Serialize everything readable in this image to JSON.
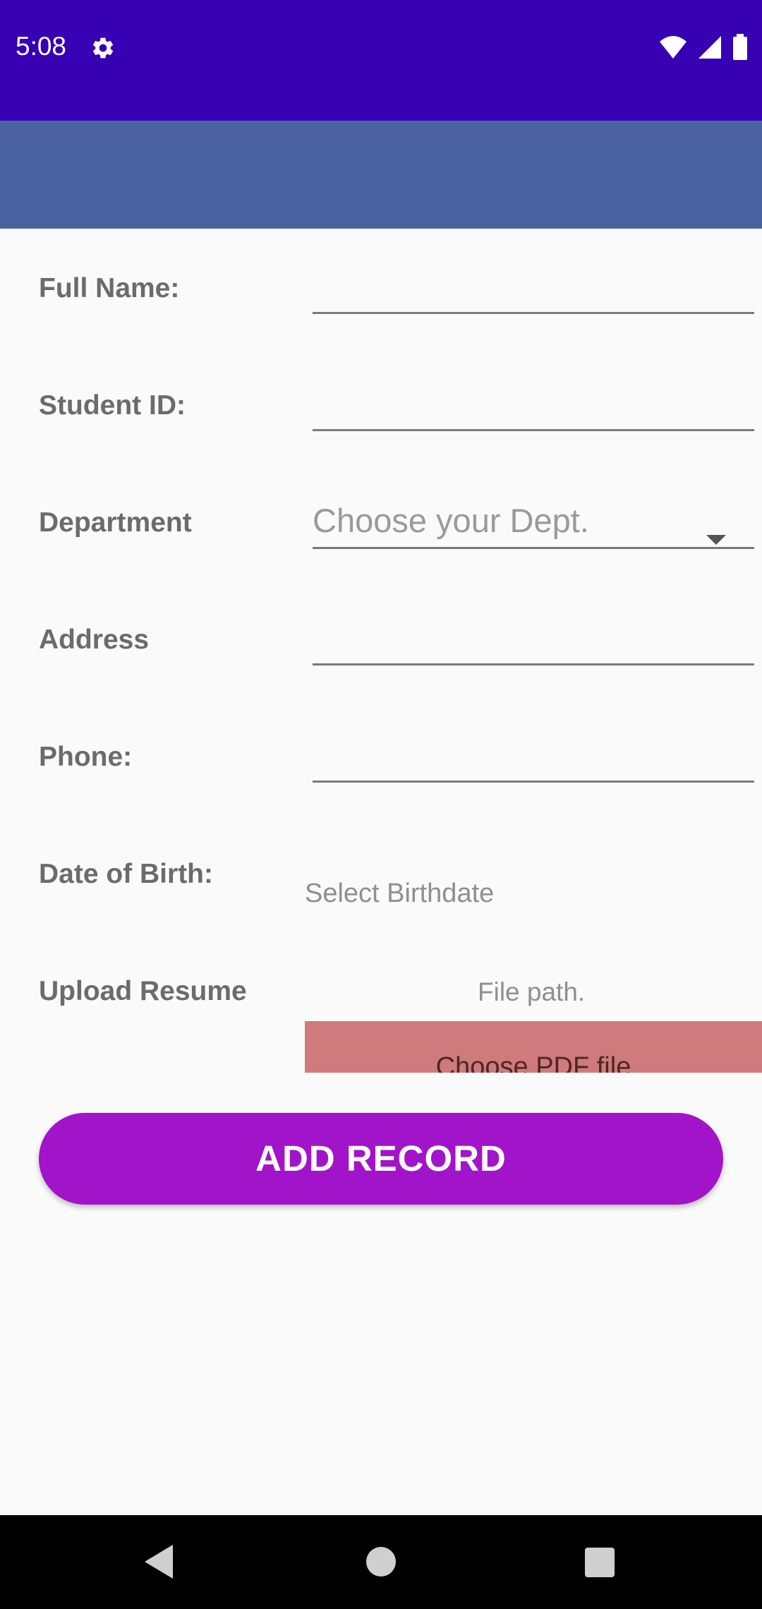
{
  "status_bar": {
    "time": "5:08",
    "icons": [
      "settings-icon",
      "wifi-icon",
      "cell-signal-icon",
      "battery-icon"
    ]
  },
  "form": {
    "full_name": {
      "label": "Full Name:",
      "value": ""
    },
    "student_id": {
      "label": "Student ID:",
      "value": ""
    },
    "department": {
      "label": "Department",
      "placeholder": "Choose your Dept."
    },
    "address": {
      "label": "Address",
      "value": ""
    },
    "phone": {
      "label": "Phone:",
      "value": ""
    },
    "date_of_birth": {
      "label": "Date of Birth:",
      "button_text": "Select Birthdate"
    },
    "upload_resume": {
      "label": "Upload Resume",
      "file_path": "File path.",
      "button_text": "Choose PDF file"
    }
  },
  "actions": {
    "add_record": "ADD RECORD"
  },
  "colors": {
    "status_bar": "#3700b3",
    "app_bar": "#4a63a0",
    "add_button": "#a214c9",
    "pdf_button": "#cf7a7c",
    "background": "#fafafa"
  },
  "nav_bar": {
    "icons": [
      "back-icon",
      "home-icon",
      "recents-icon"
    ]
  }
}
